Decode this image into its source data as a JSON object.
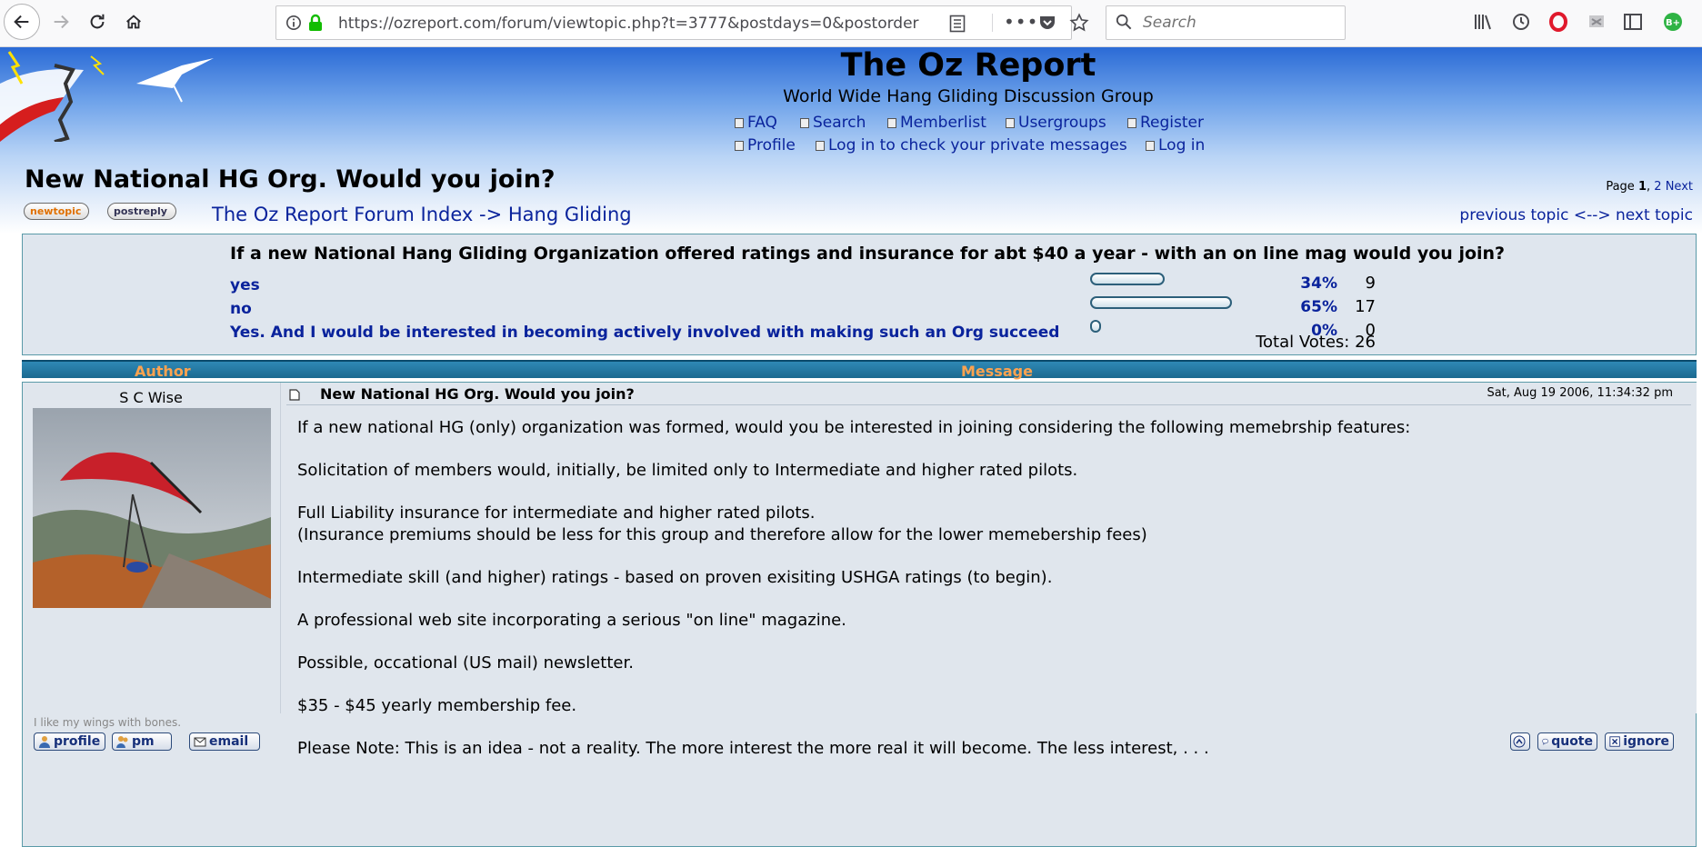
{
  "browser": {
    "url": "https://ozreport.com/forum/viewtopic.php?t=3777&postdays=0&postorder=",
    "search_placeholder": "Search",
    "profile_badge": "B+"
  },
  "site": {
    "title": "The Oz Report",
    "description": "World Wide Hang Gliding Discussion Group",
    "links": {
      "faq": "FAQ",
      "search": "Search",
      "memberlist": "Memberlist",
      "usergroups": "Usergroups",
      "register": "Register",
      "profile": "Profile",
      "pm": "Log in to check your private messages",
      "login": "Log in"
    }
  },
  "topic": {
    "title": "New National HG Org. Would you join?",
    "pagination": {
      "label": "Page",
      "current": "1",
      "sep": ",",
      "page2": "2",
      "next": "Next"
    },
    "buttons": {
      "new_topic": "newtopic",
      "post_reply": "postreply"
    },
    "breadcrumb": {
      "index": "The Oz Report Forum Index",
      "arrow": "->",
      "forum": "Hang Gliding"
    },
    "nav": {
      "previous": "previous topic",
      "sep": "<-->",
      "next": "next topic"
    }
  },
  "poll": {
    "question": "If a new National Hang Gliding Organization offered ratings and insurance for abt $40 a year - with an on line mag would you join?",
    "options": [
      {
        "label": "yes",
        "percent": "34%",
        "votes": "9",
        "fraction": 0.34
      },
      {
        "label": "no",
        "percent": "65%",
        "votes": "17",
        "fraction": 0.65
      },
      {
        "label": "Yes. And I would be interested in becoming actively involved with making such an Org succeed",
        "percent": "0%",
        "votes": "0",
        "fraction": 0.0
      }
    ],
    "total_label": "Total Votes: 26"
  },
  "thread_header": {
    "author": "Author",
    "message": "Message"
  },
  "post": {
    "author": "S C Wise",
    "subject": "New National HG Org. Would you join?",
    "date": "Sat, Aug 19 2006, 11:34:32 pm",
    "paragraphs": [
      "If a new national HG (only) organization was formed, would you be interested in joining considering the following memebrship features:",
      "Solicitation of members would, initially, be limited only to Intermediate and higher rated pilots.",
      "Full Liability insurance for intermediate and higher rated pilots.\n(Insurance premiums should be less for this group and therefore allow for the lower memebership fees)",
      "Intermediate skill (and higher) ratings - based on proven exisiting USHGA ratings (to begin).",
      "A professional web site incorporating a serious \"on line\" magazine.",
      "Possible, occational (US mail) newsletter.",
      "$35 - $45 yearly membership fee.",
      "Please Note: This is an idea - not a reality. The more interest the more real it will become. The less interest, . . ."
    ],
    "signature": "I like my wings with bones.",
    "actions": {
      "profile": "profile",
      "pm": "pm",
      "email": "email",
      "quote": "quote",
      "ignore": "ignore"
    }
  },
  "colors": {
    "link": "#0a239c",
    "header_bg": "#1b6990",
    "header_text": "#ffa34f",
    "panel_bg": "#e0e6ed"
  }
}
